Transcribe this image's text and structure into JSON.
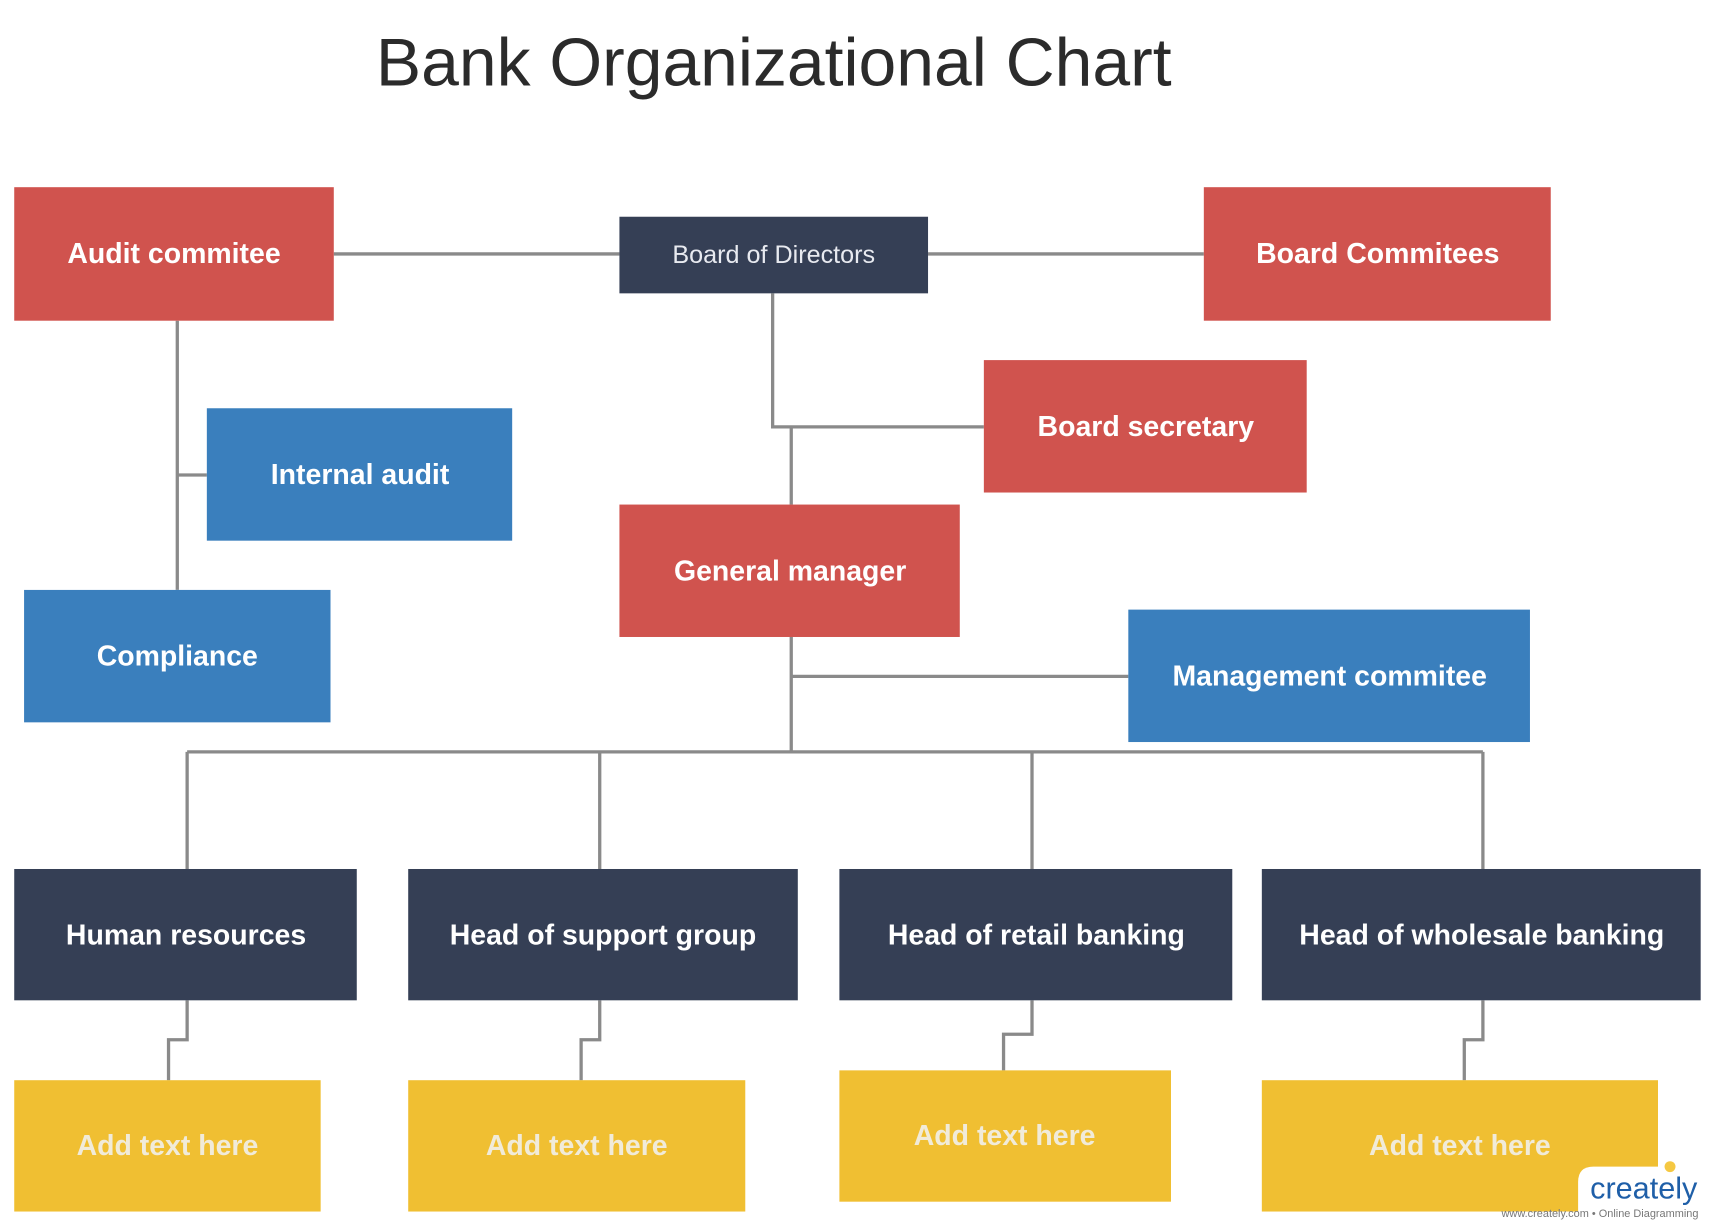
{
  "title": "Bank Organizational Chart",
  "colors": {
    "red": "#D0534E",
    "navy": "#353F55",
    "blue": "#3A7FBD",
    "yellow": "#F0BF32",
    "connector": "#8A8A8A"
  },
  "nodes": {
    "board_of_directors": "Board of Directors",
    "audit_committee": "Audit commitee",
    "board_committees": "Board Commitees",
    "board_secretary": "Board secretary",
    "internal_audit": "Internal audit",
    "general_manager": "General manager",
    "compliance": "Compliance",
    "management_committee": "Management commitee",
    "human_resources": "Human resources",
    "head_support": "Head of support group",
    "head_retail": "Head of retail banking",
    "head_wholesale": "Head of wholesale banking",
    "placeholders": [
      "Add text here",
      "Add text here",
      "Add text here",
      "Add text here"
    ]
  },
  "watermark": {
    "logo": "creately",
    "tagline": "www.creately.com • Online Diagramming"
  }
}
